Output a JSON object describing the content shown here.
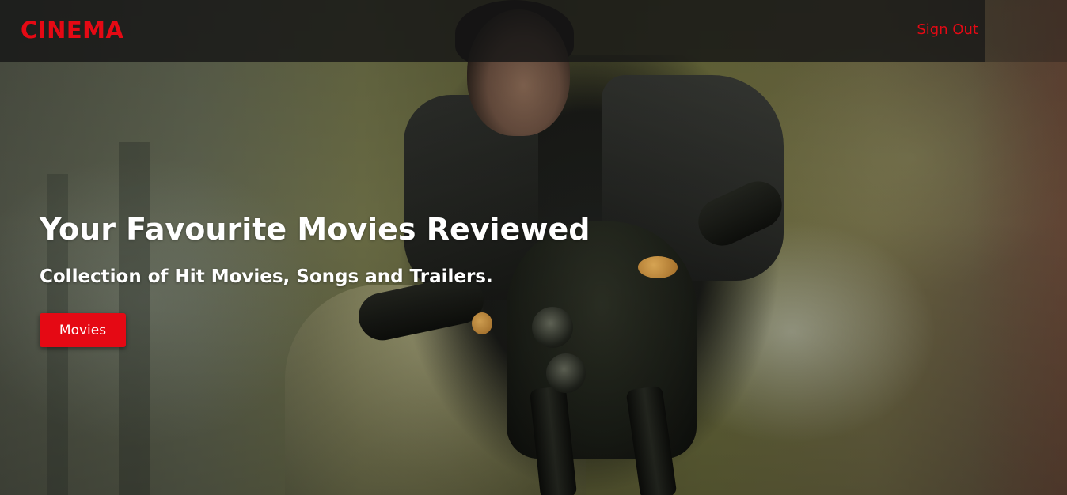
{
  "navbar": {
    "logo": "CINEMA",
    "sign_out_label": "Sign Out"
  },
  "hero": {
    "headline": "Your Favourite Movies Reviewed",
    "subheadline": "Collection of Hit Movies, Songs and Trailers.",
    "movies_button_label": "Movies",
    "background_image": "rider-on-motorcycle"
  },
  "colors": {
    "accent": "#e50914",
    "navbar_background": "#161616",
    "text": "#ffffff"
  }
}
